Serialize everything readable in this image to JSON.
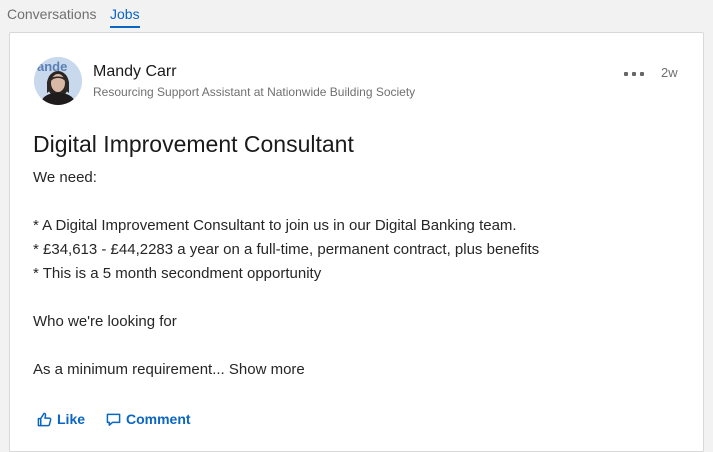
{
  "tabs": [
    {
      "label": "Conversations",
      "active": false
    },
    {
      "label": "Jobs",
      "active": true
    }
  ],
  "post": {
    "author": {
      "name": "Mandy Carr",
      "headline": "Resourcing Support Assistant at Nationwide Building Society"
    },
    "timestamp": "2w",
    "title": "Digital Improvement Consultant",
    "body_lines": [
      "We need:",
      "",
      "* A Digital Improvement Consultant to join us in our Digital Banking team.",
      "* £34,613 - £44,2283 a year on a full-time, permanent contract, plus benefits",
      "* This is a 5 month secondment opportunity",
      "",
      "Who we're looking for",
      "",
      "As a minimum requirement..."
    ],
    "show_more_label": "Show more"
  },
  "actions": {
    "like_label": "Like",
    "comment_label": "Comment"
  },
  "icons": {
    "more": "more-horizontal-icon",
    "like": "thumbs-up-icon",
    "comment": "speech-bubble-icon"
  },
  "colors": {
    "accent": "#0a66c2",
    "muted_text": "#707070",
    "background": "#f2f2f2",
    "card": "#ffffff"
  }
}
